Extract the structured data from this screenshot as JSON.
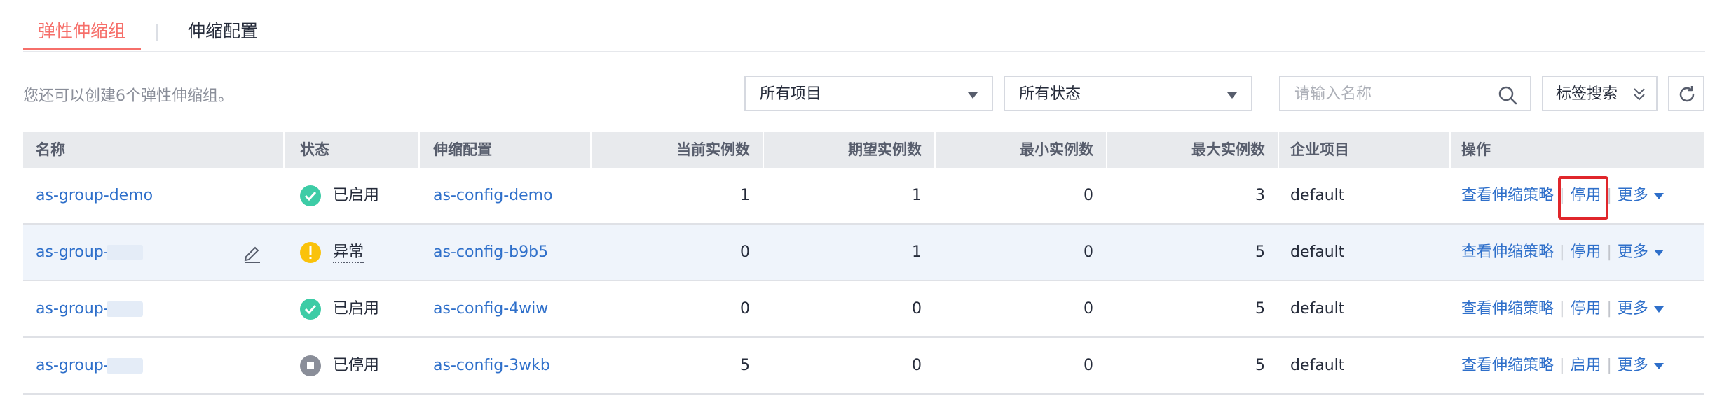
{
  "tabs": [
    {
      "label": "弹性伸缩组",
      "active": true
    },
    {
      "label": "伸缩配置",
      "active": false
    }
  ],
  "quota_text": "您还可以创建6个弹性伸缩组。",
  "filters": {
    "project": "所有项目",
    "status": "所有状态",
    "search_placeholder": "请输入名称",
    "tag_search": "标签搜索"
  },
  "columns": [
    "名称",
    "状态",
    "伸缩配置",
    "当前实例数",
    "期望实例数",
    "最小实例数",
    "最大实例数",
    "企业项目",
    "操作"
  ],
  "rows": [
    {
      "name": "as-group-demo",
      "status": "已启用",
      "status_type": "enabled",
      "config": "as-config-demo",
      "current": "1",
      "desired": "1",
      "min": "0",
      "max": "3",
      "project": "default",
      "op1": "查看伸缩策略",
      "op2": "停用",
      "op3": "更多"
    },
    {
      "name": "as-group-",
      "status": "异常",
      "status_type": "error",
      "config": "as-config-b9b5",
      "current": "0",
      "desired": "1",
      "min": "0",
      "max": "5",
      "project": "default",
      "op1": "查看伸缩策略",
      "op2": "停用",
      "op3": "更多"
    },
    {
      "name": "as-group-",
      "status": "已启用",
      "status_type": "enabled",
      "config": "as-config-4wiw",
      "current": "0",
      "desired": "0",
      "min": "0",
      "max": "5",
      "project": "default",
      "op1": "查看伸缩策略",
      "op2": "停用",
      "op3": "更多"
    },
    {
      "name": "as-group-",
      "status": "已停用",
      "status_type": "stopped",
      "config": "as-config-3wkb",
      "current": "5",
      "desired": "0",
      "min": "0",
      "max": "5",
      "project": "default",
      "op1": "查看伸缩策略",
      "op2": "启用",
      "op3": "更多"
    }
  ],
  "colors": {
    "accent": "#f66f6a",
    "link": "#2e6fca",
    "enabled": "#3dcca6",
    "error": "#fac20a",
    "stopped": "#8a8e99",
    "highlight": "#e0262b"
  }
}
